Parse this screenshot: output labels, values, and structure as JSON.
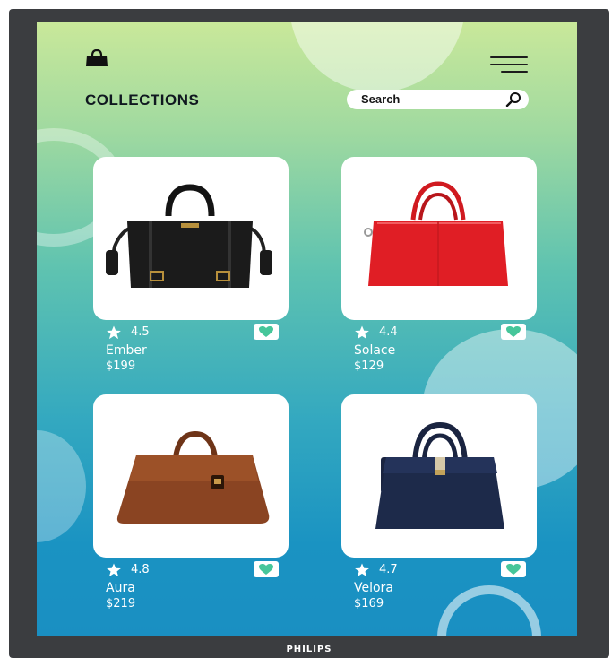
{
  "header": {
    "title": "COLLECTIONS"
  },
  "search": {
    "placeholder": "Search"
  },
  "monitor": {
    "brand": "PHILIPS"
  },
  "products": [
    {
      "name": "Ember",
      "price": "$199",
      "rating": "4.5",
      "color": "#1b1b1b"
    },
    {
      "name": "Solace",
      "price": "$129",
      "rating": "4.4",
      "color": "#e01e25"
    },
    {
      "name": "Aura",
      "price": "$219",
      "rating": "4.8",
      "color": "#8a4422"
    },
    {
      "name": "Velora",
      "price": "$169",
      "rating": "4.7",
      "color": "#1d2a4a"
    }
  ],
  "colors": {
    "heart": "#46c69a",
    "text": "#ffffff"
  },
  "icons": {
    "logo": "shopping-bag-icon",
    "menu": "hamburger-menu-icon",
    "search": "magnifier-icon",
    "rating": "star-icon",
    "favorite": "heart-icon"
  }
}
